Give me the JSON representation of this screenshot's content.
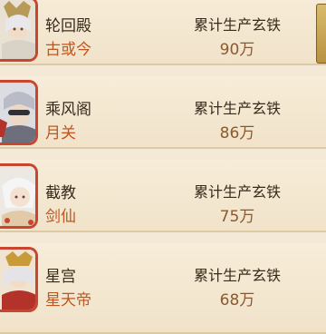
{
  "colors": {
    "background": "#f3e9d6",
    "guild_name": "#3a2a1c",
    "leader_name": "#c0561e",
    "stat_value": "#8a5a2e",
    "avatar_frame": "#c8462f"
  },
  "rows": [
    {
      "guild": "轮回殿",
      "leader": "古或今",
      "stat_label": "累计生产玄铁",
      "stat_value": "90万",
      "avatar_icon": "character-portrait-icon"
    },
    {
      "guild": "乘风阁",
      "leader": "月关",
      "stat_label": "累计生产玄铁",
      "stat_value": "86万",
      "avatar_icon": "character-portrait-icon"
    },
    {
      "guild": "截教",
      "leader": "剑仙",
      "stat_label": "累计生产玄铁",
      "stat_value": "75万",
      "avatar_icon": "character-portrait-icon"
    },
    {
      "guild": "星宫",
      "leader": "星天帝",
      "stat_label": "累计生产玄铁",
      "stat_value": "68万",
      "avatar_icon": "character-portrait-icon"
    }
  ]
}
